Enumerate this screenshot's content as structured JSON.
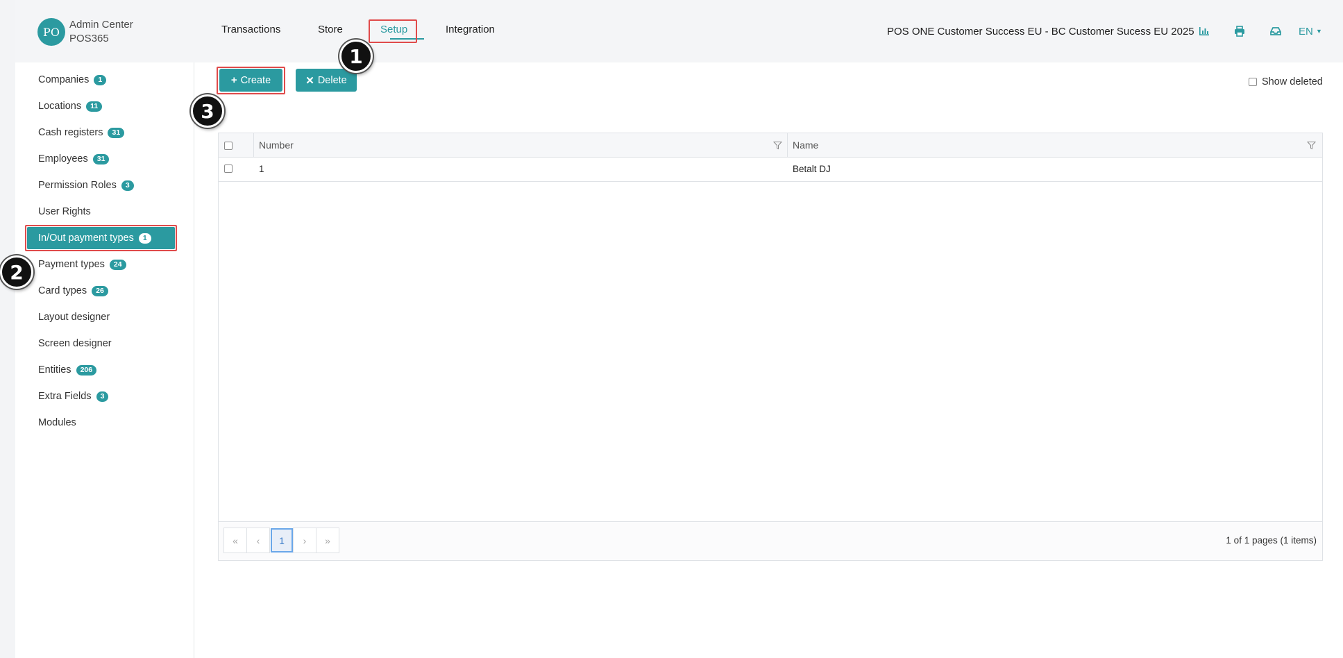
{
  "brand": {
    "avatar_initials": "PO",
    "title": "Admin Center",
    "subtitle": "POS365"
  },
  "topnav": {
    "items": [
      {
        "label": "Transactions"
      },
      {
        "label": "Store"
      },
      {
        "label": "Setup",
        "active": true
      },
      {
        "label": "Integration"
      }
    ]
  },
  "header": {
    "tenant": "POS ONE Customer Success EU - BC Customer Sucess EU 2025",
    "icons": [
      "chart-icon",
      "print-icon",
      "inbox-icon"
    ],
    "language": "EN"
  },
  "sidebar": {
    "items": [
      {
        "label": "Companies",
        "badge": "1"
      },
      {
        "label": "Locations",
        "badge": "11"
      },
      {
        "label": "Cash registers",
        "badge": "31"
      },
      {
        "label": "Employees",
        "badge": "31"
      },
      {
        "label": "Permission Roles",
        "badge": "3"
      },
      {
        "label": "User Rights",
        "badge": ""
      },
      {
        "label": "In/Out payment types",
        "badge": "1",
        "active": true
      },
      {
        "label": "Payment types",
        "badge": "24"
      },
      {
        "label": "Card types",
        "badge": "26"
      },
      {
        "label": "Layout designer",
        "badge": ""
      },
      {
        "label": "Screen designer",
        "badge": ""
      },
      {
        "label": "Entities",
        "badge": "206"
      },
      {
        "label": "Extra Fields",
        "badge": "3"
      },
      {
        "label": "Modules",
        "badge": ""
      }
    ]
  },
  "toolbar": {
    "create_label": "Create",
    "delete_label": "Delete",
    "show_deleted_label": "Show deleted"
  },
  "grid": {
    "columns": [
      "Number",
      "Name"
    ],
    "rows": [
      {
        "number": "1",
        "name": "Betalt DJ"
      }
    ],
    "pager": {
      "first": "«",
      "prev": "‹",
      "current": "1",
      "next": "›",
      "last": "»",
      "info": "1 of 1 pages (1 items)"
    }
  },
  "callouts": [
    "1",
    "2",
    "3"
  ],
  "colors": {
    "accent": "#2b9aa0",
    "highlight": "#e04b4b"
  }
}
